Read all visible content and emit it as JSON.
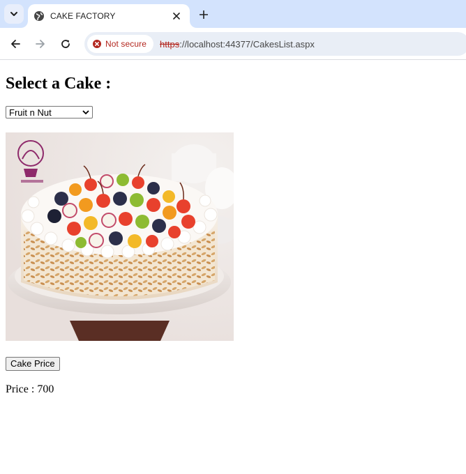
{
  "browser": {
    "tab_title": "CAKE FACTORY",
    "security_label": "Not secure",
    "url_scheme": "https",
    "url_rest": "://localhost:44377/CakesList.aspx",
    "icons": {
      "tab_search": "chevron-down-icon",
      "favicon": "globe-icon",
      "close": "close-icon",
      "new_tab": "plus-icon",
      "back": "back-arrow-icon",
      "forward": "forward-arrow-icon",
      "reload": "reload-icon",
      "security": "warning-circle-icon"
    },
    "colors": {
      "tabbar": "#d3e3fd",
      "omnibox": "#e9eef6",
      "not_secure": "#b3261e"
    }
  },
  "page": {
    "heading": "Select a Cake :",
    "selected_cake": "Fruit n Nut",
    "button_label": "Cake Price",
    "price_text": "Price : 700"
  }
}
